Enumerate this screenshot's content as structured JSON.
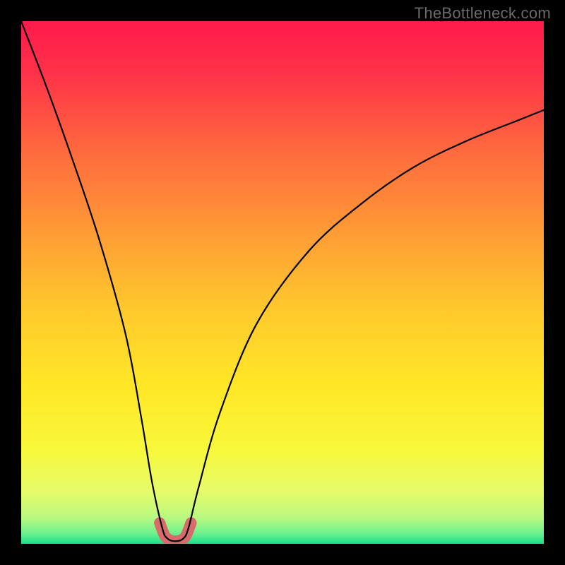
{
  "watermark": "TheBottleneck.com",
  "chart_data": {
    "type": "line",
    "title": "",
    "xlabel": "",
    "ylabel": "",
    "xlim": [
      0,
      100
    ],
    "ylim": [
      0,
      100
    ],
    "series": [
      {
        "name": "bottleneck-curve",
        "x": [
          0,
          5,
          10,
          15,
          20,
          23,
          25,
          27,
          28,
          29.5,
          31,
          32,
          34,
          38,
          45,
          55,
          65,
          75,
          85,
          95,
          100
        ],
        "y": [
          100,
          87,
          73,
          58,
          40,
          24,
          12,
          3,
          1,
          0.5,
          1,
          3,
          11,
          25,
          42,
          56,
          65,
          72,
          77,
          81,
          83
        ]
      },
      {
        "name": "highlight-band",
        "x": [
          26.5,
          27.5,
          28.5,
          29.5,
          30.5,
          31.5,
          32.5
        ],
        "y": [
          4,
          1.5,
          0.7,
          0.5,
          0.7,
          1.5,
          4
        ]
      }
    ],
    "gradient_stops": [
      {
        "pos": 0.0,
        "color": "#ff1a4b"
      },
      {
        "pos": 0.1,
        "color": "#ff3249"
      },
      {
        "pos": 0.25,
        "color": "#ff6a3e"
      },
      {
        "pos": 0.4,
        "color": "#ff9a35"
      },
      {
        "pos": 0.55,
        "color": "#ffc82c"
      },
      {
        "pos": 0.7,
        "color": "#ffe726"
      },
      {
        "pos": 0.82,
        "color": "#f8f83a"
      },
      {
        "pos": 0.9,
        "color": "#e7fb6a"
      },
      {
        "pos": 0.95,
        "color": "#b8f97f"
      },
      {
        "pos": 0.98,
        "color": "#6ef18e"
      },
      {
        "pos": 1.0,
        "color": "#17e08b"
      }
    ],
    "curve_color": "#000000",
    "highlight_color": "#d86a6a"
  }
}
